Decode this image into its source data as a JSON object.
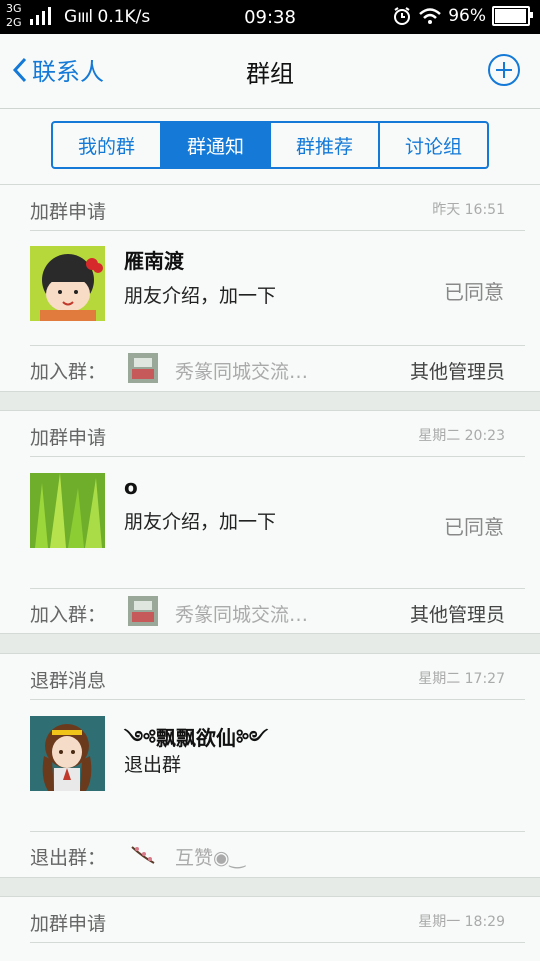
{
  "statusbar": {
    "signal_top": "3G",
    "signal_bottom": "2G",
    "carrier_signal": "G",
    "net_speed": "0.1K/s",
    "time": "09:38",
    "battery": "96%",
    "battery_level": 0.96
  },
  "nav": {
    "back_label": "联系人",
    "title": "群组"
  },
  "tabs": [
    {
      "label": "我的群"
    },
    {
      "label": "群通知"
    },
    {
      "label": "群推荐"
    },
    {
      "label": "讨论组"
    }
  ],
  "notifications": [
    {
      "type": "加群申请",
      "time": "昨天 16:51",
      "name": "雁南渡",
      "message": "朋友介绍，加一下",
      "status": "已同意",
      "group_label": "加入群：",
      "group_name": "秀篆同城交流…",
      "handler": "其他管理员"
    },
    {
      "type": "加群申请",
      "time": "星期二 20:23",
      "name": "o",
      "message": "朋友介绍，加一下",
      "status": "已同意",
      "group_label": "加入群：",
      "group_name": "秀篆同城交流…",
      "handler": "其他管理员"
    },
    {
      "type": "退群消息",
      "time": "星期二 17:27",
      "name": "༺飘飘欲仙༻",
      "message": "退出群",
      "group_label": "退出群：",
      "group_name": "互赞◉‿"
    },
    {
      "type": "加群申请",
      "time": "星期一 18:29"
    }
  ]
}
